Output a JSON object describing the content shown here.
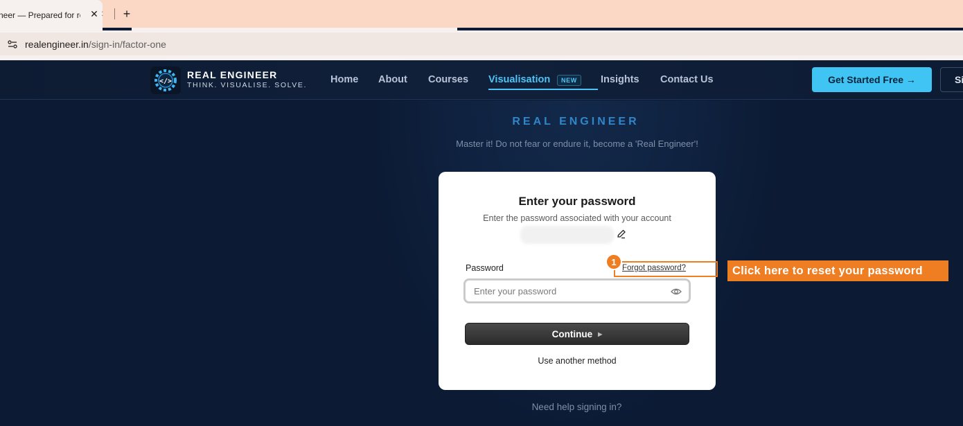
{
  "browser": {
    "tab_title": "neer — Prepared for re",
    "tab_ghost": ":",
    "new_tab_label": "+",
    "close_label": "✕",
    "url_domain": "realengineer.in",
    "url_path": "/sign-in/factor-one"
  },
  "header": {
    "brand_name": "REAL ENGINEER",
    "brand_tagline": "THINK. VISUALISE. SOLVE.",
    "nav": [
      {
        "label": "Home"
      },
      {
        "label": "About"
      },
      {
        "label": "Courses"
      },
      {
        "label": "Visualisation",
        "badge": "NEW",
        "active": true
      },
      {
        "label": "Insights"
      },
      {
        "label": "Contact Us"
      }
    ],
    "cta_label": "Get Started Free →",
    "signin_label": "Si"
  },
  "hero": {
    "title": "REAL ENGINEER",
    "subtitle": "Master it! Do not fear or endure it, become a 'Real Engineer'!"
  },
  "card": {
    "title": "Enter your password",
    "subtitle": "Enter the password associated with your account",
    "password_label": "Password",
    "forgot_label": "Forgot password?",
    "password_placeholder": "Enter your password",
    "continue_label": "Continue",
    "continue_arrow": "▶",
    "another_method_label": "Use another method"
  },
  "help_text": "Need help signing in?",
  "annotation": {
    "step": "1",
    "callout": "Click here to reset your password",
    "color": "#ef7d22"
  },
  "colors": {
    "accent": "#3fc4f4",
    "background": "#0c1a33",
    "hero_title": "#2f86c9"
  }
}
